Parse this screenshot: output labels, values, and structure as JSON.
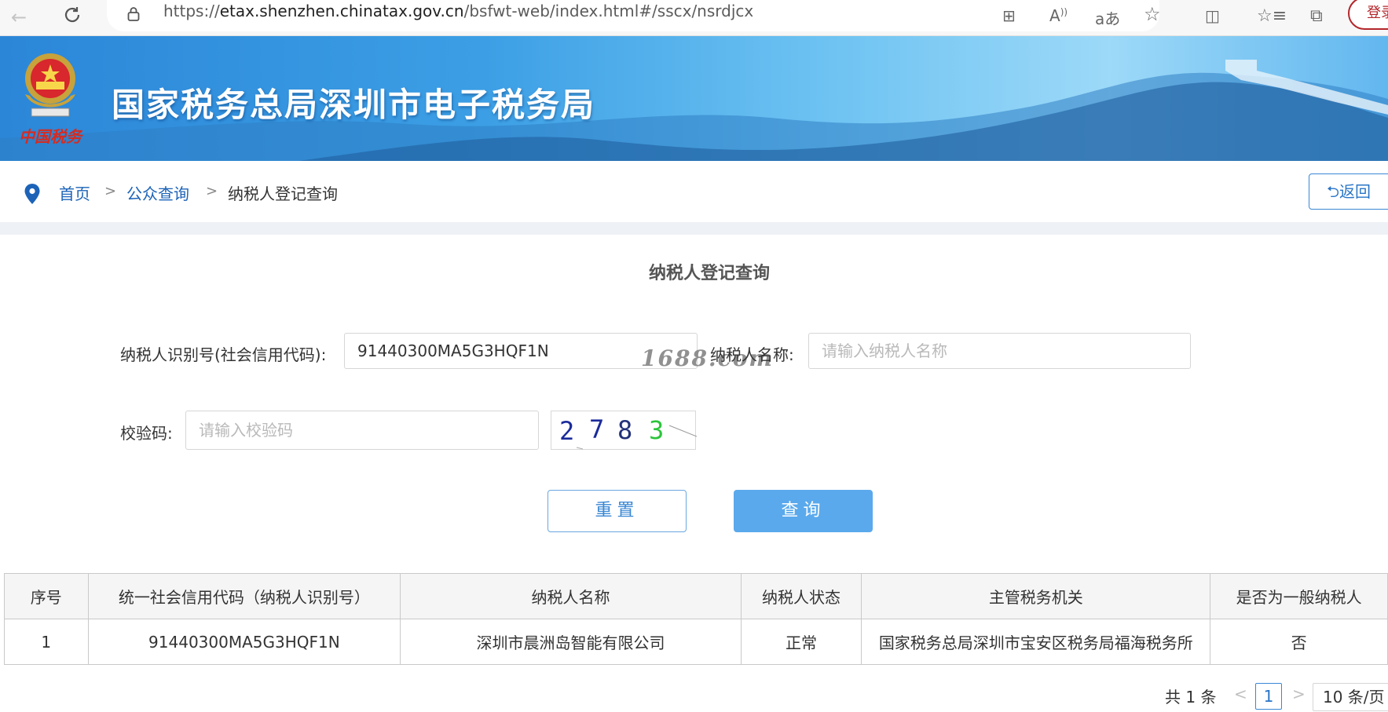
{
  "browser": {
    "url_prefix": "https://",
    "url_domain": "etax.shenzhen.chinatax.gov.cn",
    "url_path": "/bsfwt-web/index.html#/sscx/nsrdjcx",
    "login_label": "登录"
  },
  "banner": {
    "title": "国家税务总局深圳市电子税务局",
    "logo_caption": "中国税务"
  },
  "breadcrumb": {
    "home": "首页",
    "sep1": ">",
    "public_query": "公众查询",
    "sep2": ">",
    "current": "纳税人登记查询",
    "back_label": "返回"
  },
  "form": {
    "title": "纳税人登记查询",
    "taxpayer_id_label": "纳税人识别号(社会信用代码):",
    "taxpayer_id_value": "91440300MA5G3HQF1N",
    "taxpayer_name_label": "纳税人名称:",
    "taxpayer_name_placeholder": "请输入纳税人名称",
    "captcha_label": "校验码:",
    "captcha_placeholder": "请输入校验码",
    "captcha_chars": [
      "2",
      "7",
      "8",
      "3"
    ],
    "reset_label": "重置",
    "query_label": "查询",
    "watermark": "1688.com"
  },
  "table": {
    "headers": [
      "序号",
      "统一社会信用代码（纳税人识别号）",
      "纳税人名称",
      "纳税人状态",
      "主管税务机关",
      "是否为一般纳税人"
    ],
    "rows": [
      [
        "1",
        "91440300MA5G3HQF1N",
        "深圳市晨洲岛智能有限公司",
        "正常",
        "国家税务总局深圳市宝安区税务局福海税务所",
        "否"
      ]
    ]
  },
  "pagination": {
    "total_text": "共 1 条",
    "current_page": "1",
    "page_size": "10 条/页"
  },
  "colors": {
    "link": "#1c63b8",
    "primary": "#5aa9ec",
    "login_border": "#b3262b"
  }
}
